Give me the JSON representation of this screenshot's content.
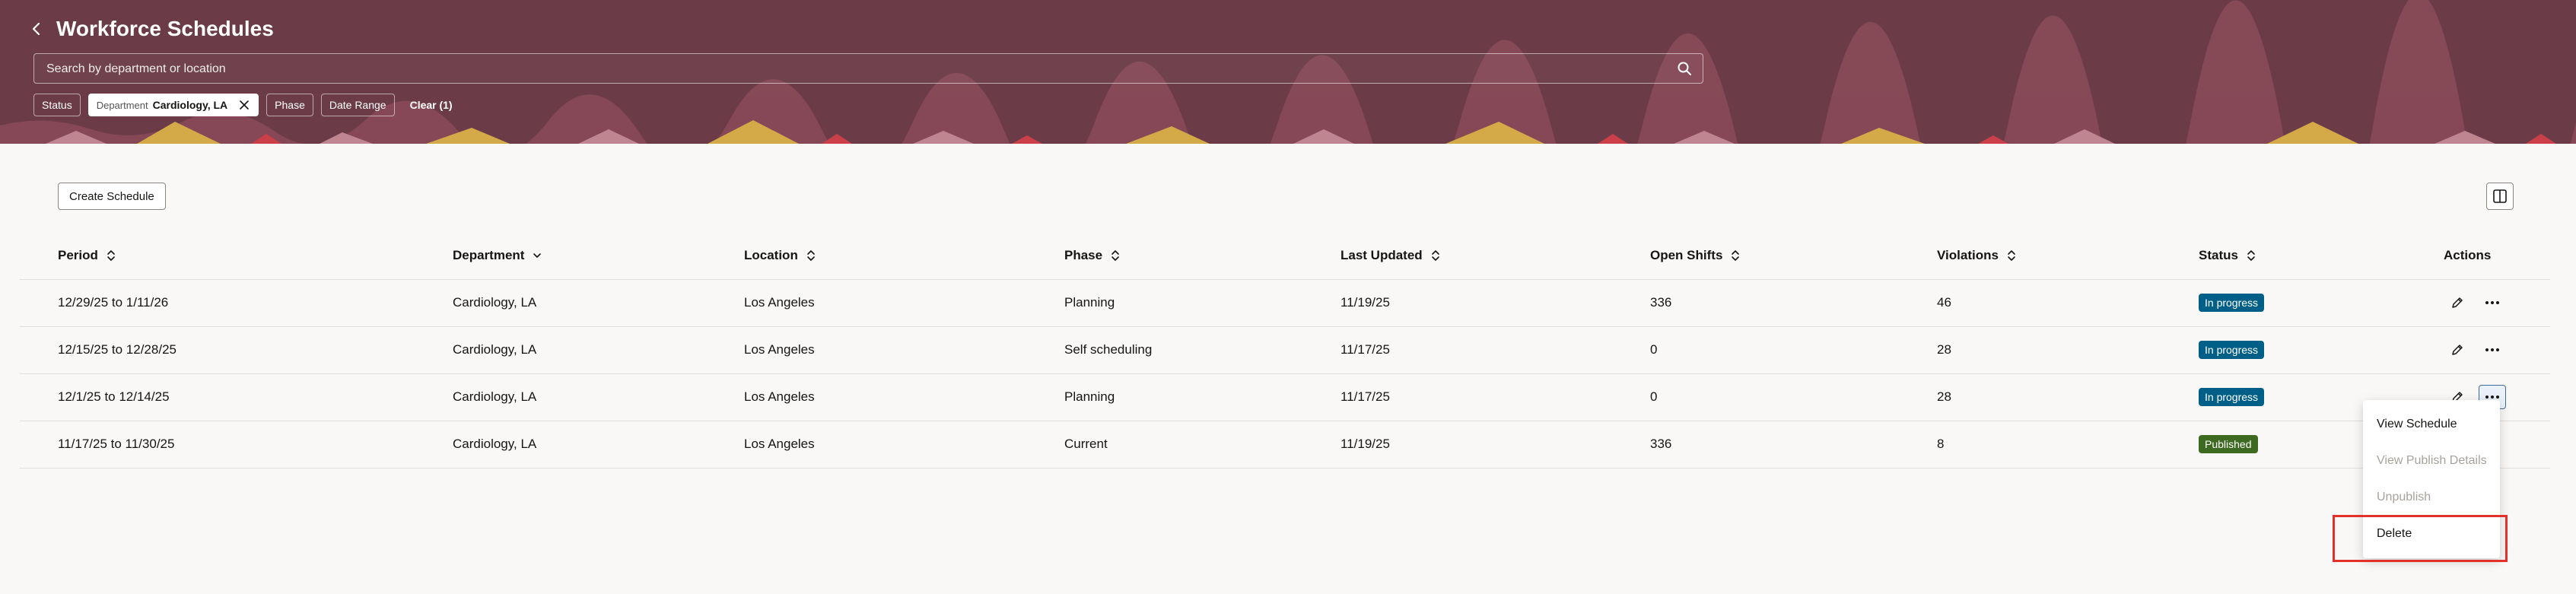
{
  "header": {
    "title": "Workforce Schedules",
    "search_placeholder": "Search by department or location",
    "filters": [
      {
        "label": "Status"
      },
      {
        "key": "Department",
        "value": "Cardiology, LA"
      },
      {
        "label": "Phase"
      },
      {
        "label": "Date Range"
      }
    ],
    "clear_label": "Clear (1)"
  },
  "toolbar": {
    "create_label": "Create Schedule"
  },
  "table": {
    "columns": [
      "Period",
      "Department",
      "Location",
      "Phase",
      "Last Updated",
      "Open Shifts",
      "Violations",
      "Status",
      "Actions"
    ],
    "rows": [
      {
        "period": "12/29/25 to 1/11/26",
        "department": "Cardiology, LA",
        "location": "Los Angeles",
        "phase": "Planning",
        "last_updated": "11/19/25",
        "open_shifts": "336",
        "violations": "46",
        "status": "In progress"
      },
      {
        "period": "12/15/25 to 12/28/25",
        "department": "Cardiology, LA",
        "location": "Los Angeles",
        "phase": "Self scheduling",
        "last_updated": "11/17/25",
        "open_shifts": "0",
        "violations": "28",
        "status": "In progress"
      },
      {
        "period": "12/1/25 to 12/14/25",
        "department": "Cardiology, LA",
        "location": "Los Angeles",
        "phase": "Planning",
        "last_updated": "11/17/25",
        "open_shifts": "0",
        "violations": "28",
        "status": "In progress"
      },
      {
        "period": "11/17/25 to 11/30/25",
        "department": "Cardiology, LA",
        "location": "Los Angeles",
        "phase": "Current",
        "last_updated": "11/19/25",
        "open_shifts": "336",
        "violations": "8",
        "status": "Published"
      }
    ]
  },
  "menu": {
    "items": [
      {
        "label": "View Schedule",
        "enabled": true
      },
      {
        "label": "View Publish Details",
        "enabled": false
      },
      {
        "label": "Unpublish",
        "enabled": false
      },
      {
        "label": "Delete",
        "enabled": true
      }
    ]
  },
  "colors": {
    "header_bg": "#6b3c48",
    "in_progress": "#005f87",
    "published": "#3c6a20",
    "highlight": "#e0322b"
  }
}
